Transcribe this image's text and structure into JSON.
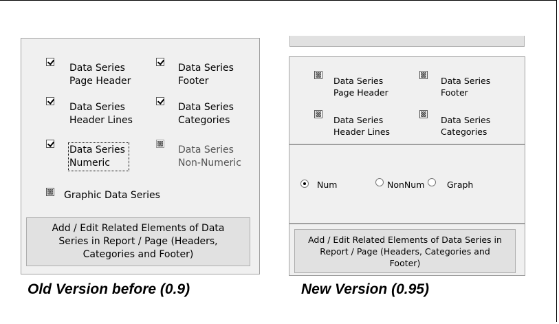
{
  "old_version": {
    "checkboxes": [
      {
        "label": "Data Series\nPage Header",
        "state": "checked"
      },
      {
        "label": "Data Series\nFooter",
        "state": "checked"
      },
      {
        "label": "Data Series\nHeader Lines",
        "state": "checked"
      },
      {
        "label": "Data Series\nCategories",
        "state": "checked"
      },
      {
        "label": "Data Series\nNumeric",
        "state": "checked"
      },
      {
        "label": "Data Series\nNon-Numeric",
        "state": "indeterminate-disabled"
      },
      {
        "label": "Graphic Data Series",
        "state": "indeterminate"
      }
    ],
    "button_label": "Add / Edit Related Elements of  Data Series in Report / Page (Headers, Categories and Footer)",
    "caption": "Old Version before  (0.9)"
  },
  "new_version": {
    "checkboxes": [
      {
        "label": "Data Series\nPage Header",
        "state": "indeterminate"
      },
      {
        "label": "Data Series\nFooter",
        "state": "indeterminate"
      },
      {
        "label": "Data Series\nHeader Lines",
        "state": "indeterminate"
      },
      {
        "label": "Data Series\nCategories",
        "state": "indeterminate"
      }
    ],
    "radios": [
      {
        "label": "Num",
        "selected": true
      },
      {
        "label": "NonNum",
        "selected": false
      },
      {
        "label": "Graph",
        "selected": false
      }
    ],
    "button_label": "Add / Edit Related Elements of  Data Series in Report / Page (Headers, Categories and Footer)",
    "caption": "New Version (0.95)"
  }
}
